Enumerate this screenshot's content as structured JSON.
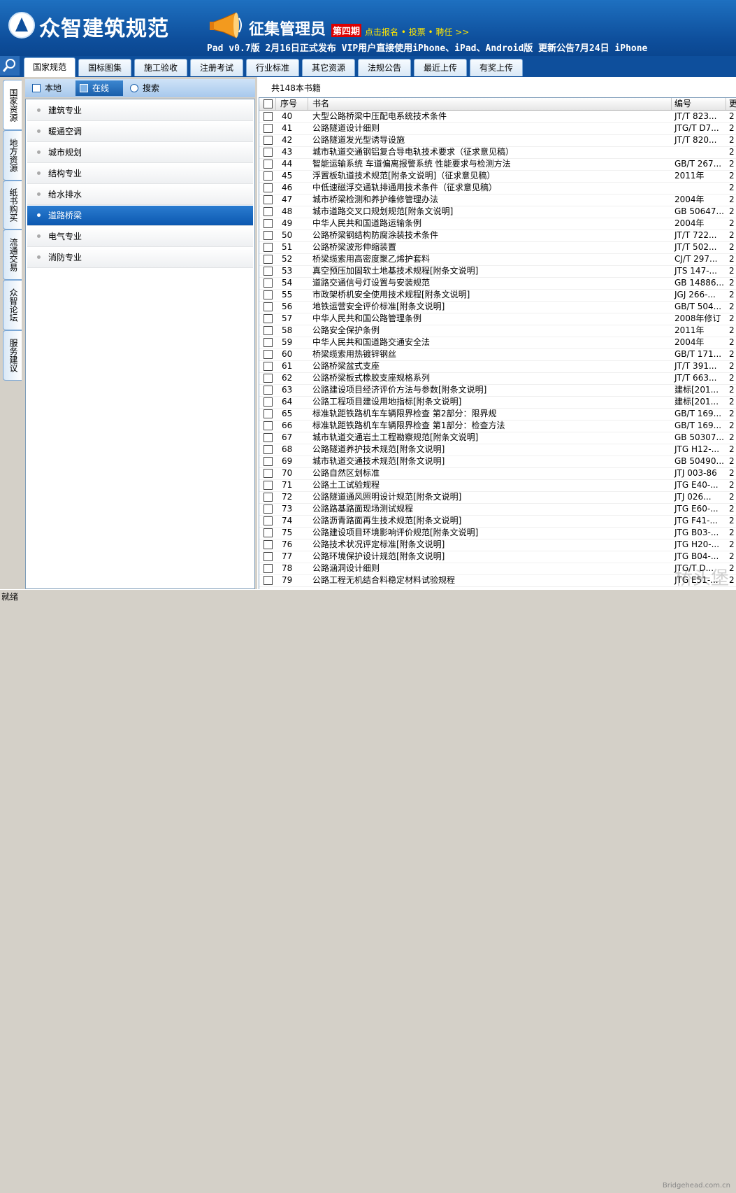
{
  "header": {
    "app_name": "众智建筑规范",
    "campaign_title": "征集管理员",
    "campaign_badge": "第四期",
    "campaign_links": "点击报名 • 投票 • 聘任 >>",
    "marquee": "Pad v0.7版 2月16日正式发布     VIP用户直接使用iPhone、iPad、Android版     更新公告7月24日     iPhone"
  },
  "tabs": [
    "国家规范",
    "国标图集",
    "施工验收",
    "注册考试",
    "行业标准",
    "其它资源",
    "法规公告",
    "最近上传",
    "有奖上传"
  ],
  "vertical_tabs": [
    "国家资源",
    "地方资源",
    "纸书购买",
    "流通交易",
    "众智论坛",
    "服务建议"
  ],
  "left_toolbar": {
    "local": "本地",
    "online": "在线",
    "search": "搜索"
  },
  "categories": [
    "建筑专业",
    "暖通空调",
    "城市规划",
    "结构专业",
    "给水排水",
    "道路桥梁",
    "电气专业",
    "消防专业"
  ],
  "selected_category": "道路桥梁",
  "book_count": "共148本书籍",
  "table": {
    "headers": [
      "序号",
      "书名",
      "编号",
      "更"
    ],
    "rows": [
      [
        "40",
        "大型公路桥梁中压配电系统技术条件",
        "JT/T 823...",
        "2"
      ],
      [
        "41",
        "公路隧道设计细则",
        "JTG/T D7...",
        "2"
      ],
      [
        "42",
        "公路隧道发光型诱导设施",
        "JT/T 820...",
        "2"
      ],
      [
        "43",
        "城市轨道交通钢铝复合导电轨技术要求（征求意见稿）",
        "",
        "2"
      ],
      [
        "44",
        "智能运输系统 车道偏离报警系统 性能要求与检测方法",
        "GB/T 267...",
        "2"
      ],
      [
        "45",
        "浮置板轨道技术规范[附条文说明]（征求意见稿）",
        "2011年",
        "2"
      ],
      [
        "46",
        "中低速磁浮交通轨排通用技术条件（征求意见稿）",
        "",
        "2"
      ],
      [
        "47",
        "城市桥梁检测和养护维修管理办法",
        "2004年",
        "2"
      ],
      [
        "48",
        "城市道路交叉口规划规范[附条文说明]",
        "GB 50647...",
        "2"
      ],
      [
        "49",
        "中华人民共和国道路运输条例",
        "2004年",
        "2"
      ],
      [
        "50",
        "公路桥梁钢结构防腐涂装技术条件",
        "JT/T 722...",
        "2"
      ],
      [
        "51",
        "公路桥梁波形伸缩装置",
        "JT/T 502...",
        "2"
      ],
      [
        "52",
        "桥梁缆索用高密度聚乙烯护套料",
        "CJ/T 297...",
        "2"
      ],
      [
        "53",
        "真空预压加固软土地基技术规程[附条文说明]",
        "JTS 147-...",
        "2"
      ],
      [
        "54",
        "道路交通信号灯设置与安装规范",
        "GB 14886...",
        "2"
      ],
      [
        "55",
        "市政架桥机安全使用技术规程[附条文说明]",
        "JGJ 266-...",
        "2"
      ],
      [
        "56",
        "地铁运营安全评价标准[附条文说明]",
        "GB/T 504...",
        "2"
      ],
      [
        "57",
        "中华人民共和国公路管理条例",
        "2008年修订",
        "2"
      ],
      [
        "58",
        "公路安全保护条例",
        "2011年",
        "2"
      ],
      [
        "59",
        "中华人民共和国道路交通安全法",
        "2004年",
        "2"
      ],
      [
        "60",
        "桥梁缆索用热镀锌钢丝",
        "GB/T 171...",
        "2"
      ],
      [
        "61",
        "公路桥梁盆式支座",
        "JT/T 391...",
        "2"
      ],
      [
        "62",
        "公路桥梁板式橡胶支座规格系列",
        "JT/T 663...",
        "2"
      ],
      [
        "63",
        "公路建设项目经济评价方法与参数[附条文说明]",
        "建标[201...",
        "2"
      ],
      [
        "64",
        "公路工程项目建设用地指标[附条文说明]",
        "建标[201...",
        "2"
      ],
      [
        "65",
        "标准轨距铁路机车车辆限界检查 第2部分：限界规",
        "GB/T 169...",
        "2"
      ],
      [
        "66",
        "标准轨距铁路机车车辆限界检查 第1部分：检查方法",
        "GB/T 169...",
        "2"
      ],
      [
        "67",
        "城市轨道交通岩土工程勘察规范[附条文说明]",
        "GB 50307...",
        "2"
      ],
      [
        "68",
        "公路隧道养护技术规范[附条文说明]",
        "JTG H12-...",
        "2"
      ],
      [
        "69",
        "城市轨道交通技术规范[附条文说明]",
        "GB 50490...",
        "2"
      ],
      [
        "70",
        "公路自然区划标准",
        "JTJ 003-86",
        "2"
      ],
      [
        "71",
        "公路土工试验规程",
        "JTG E40-...",
        "2"
      ],
      [
        "72",
        "公路隧道通风照明设计规范[附条文说明]",
        "JTJ 026...",
        "2"
      ],
      [
        "73",
        "公路路基路面现场测试规程",
        "JTG E60-...",
        "2"
      ],
      [
        "74",
        "公路沥青路面再生技术规范[附条文说明]",
        "JTG F41-...",
        "2"
      ],
      [
        "75",
        "公路建设项目环境影响评价规范[附条文说明]",
        "JTG B03-...",
        "2"
      ],
      [
        "76",
        "公路技术状况评定标准[附条文说明]",
        "JTG H20-...",
        "2"
      ],
      [
        "77",
        "公路环境保护设计规范[附条文说明]",
        "JTG B04-...",
        "2"
      ],
      [
        "78",
        "公路涵洞设计细则",
        "JTG/T D...",
        "2"
      ],
      [
        "79",
        "公路工程无机结合料稳定材料试验规程",
        "JTG E51-...",
        "2"
      ]
    ]
  },
  "status": "就绪",
  "watermark": "桥头堡",
  "watermark_url": "Bridgehead.com.cn"
}
